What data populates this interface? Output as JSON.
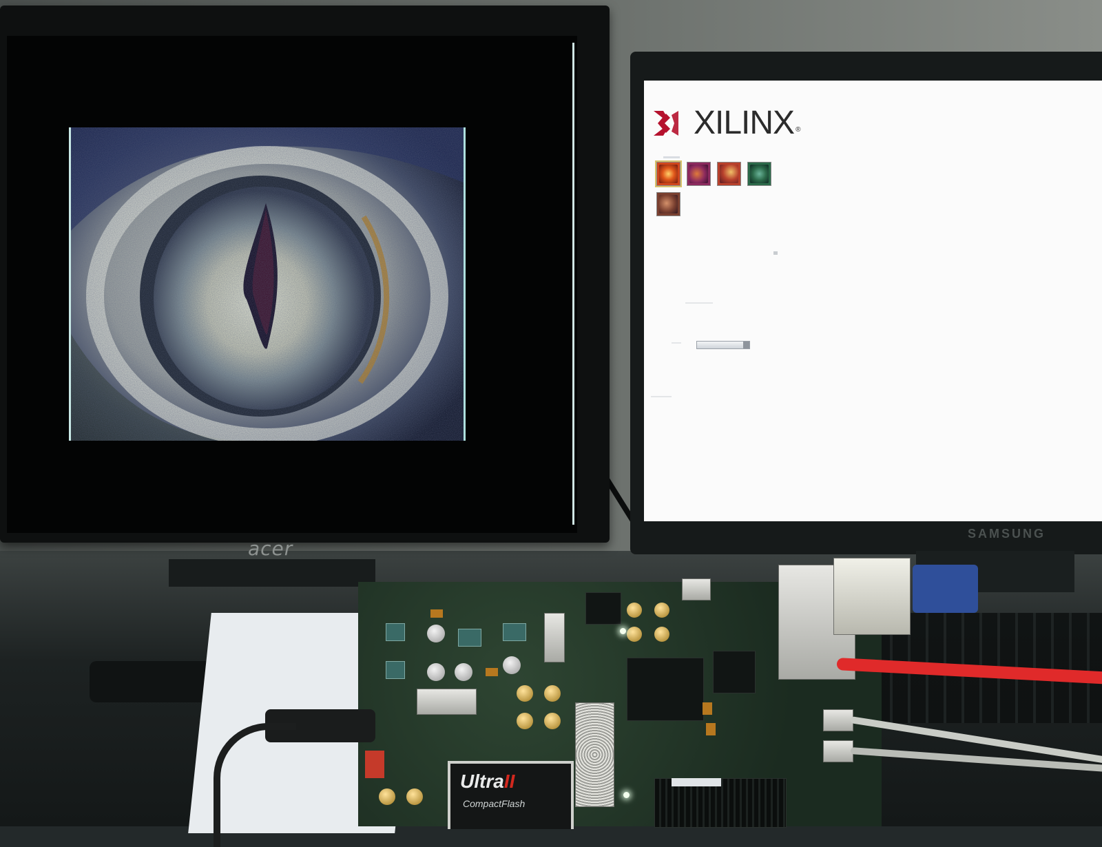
{
  "scene": {
    "left_monitor": {
      "brand": "acer",
      "display_content": "eye-image"
    },
    "right_monitor": {
      "brand": "SAMSUNG",
      "app": {
        "logo_text": "XILINX",
        "logo_reg": "®",
        "thumbnails": [
          {
            "name": "thumbnail-1",
            "color": "#d0461c",
            "selected": true
          },
          {
            "name": "thumbnail-2",
            "color": "#8c2a5e",
            "selected": false
          },
          {
            "name": "thumbnail-3",
            "color": "#b8412c",
            "selected": false
          },
          {
            "name": "thumbnail-4",
            "color": "#2c6a4a",
            "selected": false
          },
          {
            "name": "thumbnail-5",
            "color": "#7a4030",
            "selected": false
          }
        ]
      }
    },
    "board": {
      "card_text_1": "Ultra",
      "card_text_2": "II",
      "card_text_3": "CompactFlash"
    },
    "colors": {
      "xilinx_red": "#b5122e",
      "cable_red": "#e02a2a"
    }
  }
}
